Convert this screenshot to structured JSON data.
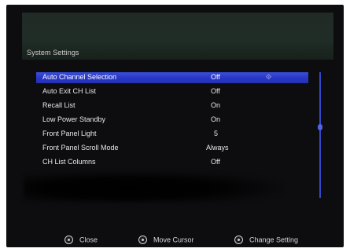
{
  "title": "System Settings",
  "rows": [
    {
      "label": "Auto Channel Selection",
      "value": "Off",
      "selected": true
    },
    {
      "label": "Auto Exit CH List",
      "value": "Off",
      "selected": false
    },
    {
      "label": "Recall List",
      "value": "On",
      "selected": false
    },
    {
      "label": "Low Power Standby",
      "value": "On",
      "selected": false
    },
    {
      "label": "Front Panel Light",
      "value": "5",
      "selected": false
    },
    {
      "label": "Front Panel Scroll Mode",
      "value": "Always",
      "selected": false
    },
    {
      "label": "CH List Columns",
      "value": "Off",
      "selected": false
    }
  ],
  "footer": {
    "close_label": "Close",
    "move_label": "Move Cursor",
    "change_label": "Change Setting"
  }
}
